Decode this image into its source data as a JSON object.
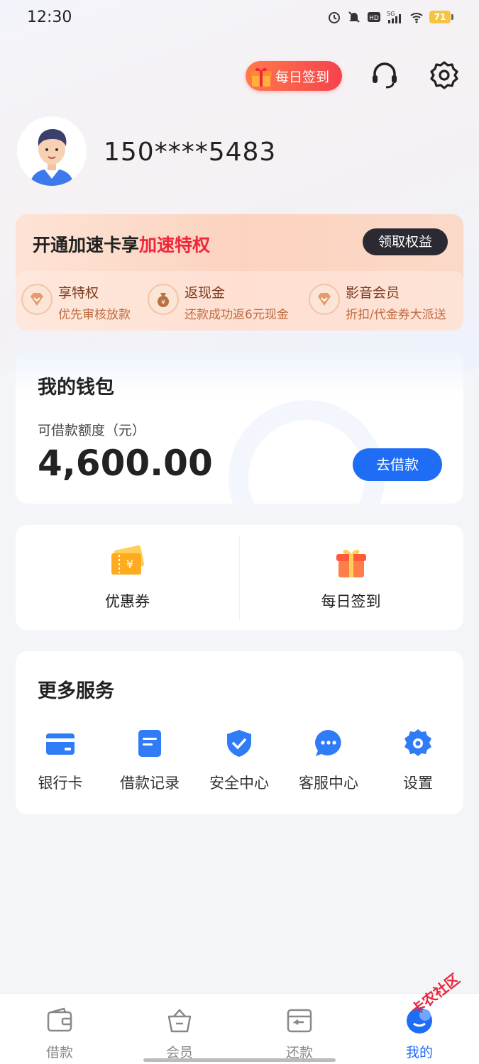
{
  "status_bar": {
    "time": "12:30",
    "battery": "71"
  },
  "header": {
    "checkin_badge": "每日签到"
  },
  "profile": {
    "phone": "150****5483"
  },
  "vip_banner": {
    "title_prefix": "开通加速卡享",
    "title_highlight": "加速特权",
    "claim_button": "领取权益",
    "perks": [
      {
        "title": "享特权",
        "desc": "优先审核放款",
        "icon": "diamond-icon"
      },
      {
        "title": "返现金",
        "desc": "还款成功返6元现金",
        "icon": "money-bag-icon"
      },
      {
        "title": "影音会员",
        "desc": "折扣/代金券大派送",
        "icon": "diamond-icon"
      }
    ]
  },
  "wallet": {
    "title": "我的钱包",
    "credit_label": "可借款额度（元）",
    "credit_amount": "4,600.00",
    "borrow_button": "去借款"
  },
  "quick_actions": [
    {
      "label": "优惠券",
      "icon": "coupon-icon"
    },
    {
      "label": "每日签到",
      "icon": "gift-icon"
    }
  ],
  "more_services": {
    "title": "更多服务",
    "items": [
      {
        "label": "银行卡",
        "icon": "bank-card-icon"
      },
      {
        "label": "借款记录",
        "icon": "record-icon"
      },
      {
        "label": "安全中心",
        "icon": "shield-icon"
      },
      {
        "label": "客服中心",
        "icon": "chat-icon"
      },
      {
        "label": "设置",
        "icon": "gear-icon"
      }
    ]
  },
  "tab_bar": {
    "tabs": [
      {
        "label": "借款",
        "icon": "wallet-icon",
        "active": false
      },
      {
        "label": "会员",
        "icon": "basket-icon",
        "active": false
      },
      {
        "label": "还款",
        "icon": "repay-icon",
        "active": false
      },
      {
        "label": "我的",
        "icon": "profile-icon",
        "active": true
      }
    ]
  },
  "watermark": "卡农社区",
  "colors": {
    "accent": "#1f6cf5",
    "highlight": "#f0263a",
    "badge": "#f5424d"
  }
}
